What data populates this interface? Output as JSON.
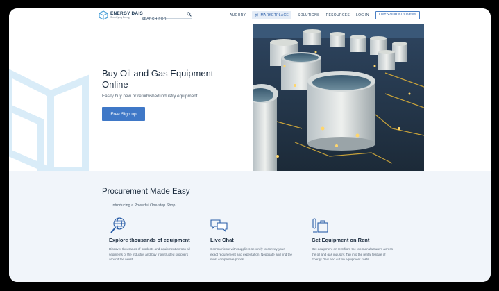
{
  "header": {
    "logo": {
      "name": "ENERGY DAIS",
      "tagline": "Simplifying Energy"
    },
    "search": {
      "placeholder": "SEARCH FOR"
    },
    "nav": [
      {
        "label": "AUGURY"
      },
      {
        "label": "MARKETPLACE"
      },
      {
        "label": "SOLUTIONS"
      },
      {
        "label": "RESOURCES"
      },
      {
        "label": "LOG IN"
      }
    ],
    "cta": "LIST YOUR BUSINESS"
  },
  "hero": {
    "title": "Buy Oil and Gas Equipment Online",
    "subtitle": "Easily buy new or refurbished industry equipment",
    "button": "Free Sign up"
  },
  "features": {
    "title": "Procurement Made Easy",
    "subtitle": "Introducing a Powerful One-stop Shop",
    "cards": [
      {
        "icon": "globe-search-icon",
        "title": "Explore thousands of equipment",
        "body": "Discover thousands of products and equipment across all segments of the industry, and buy from trusted suppliers around the world"
      },
      {
        "icon": "chat-icon",
        "title": "Live Chat",
        "body": "Communicate with suppliers securely to convey your exact requirement and expectation. Negotiate and find the most competitive prices."
      },
      {
        "icon": "equipment-rent-icon",
        "title": "Get Equipment on Rent",
        "body": "Get equipment on rent from the top manufacturers across the oil and gas industry. Tap into the rental feature of Energy Dais and cut on equipment costs."
      }
    ]
  },
  "colors": {
    "primary": "#3f78c7",
    "text_dark": "#1a2a3c",
    "section_bg": "#f1f5fa"
  }
}
